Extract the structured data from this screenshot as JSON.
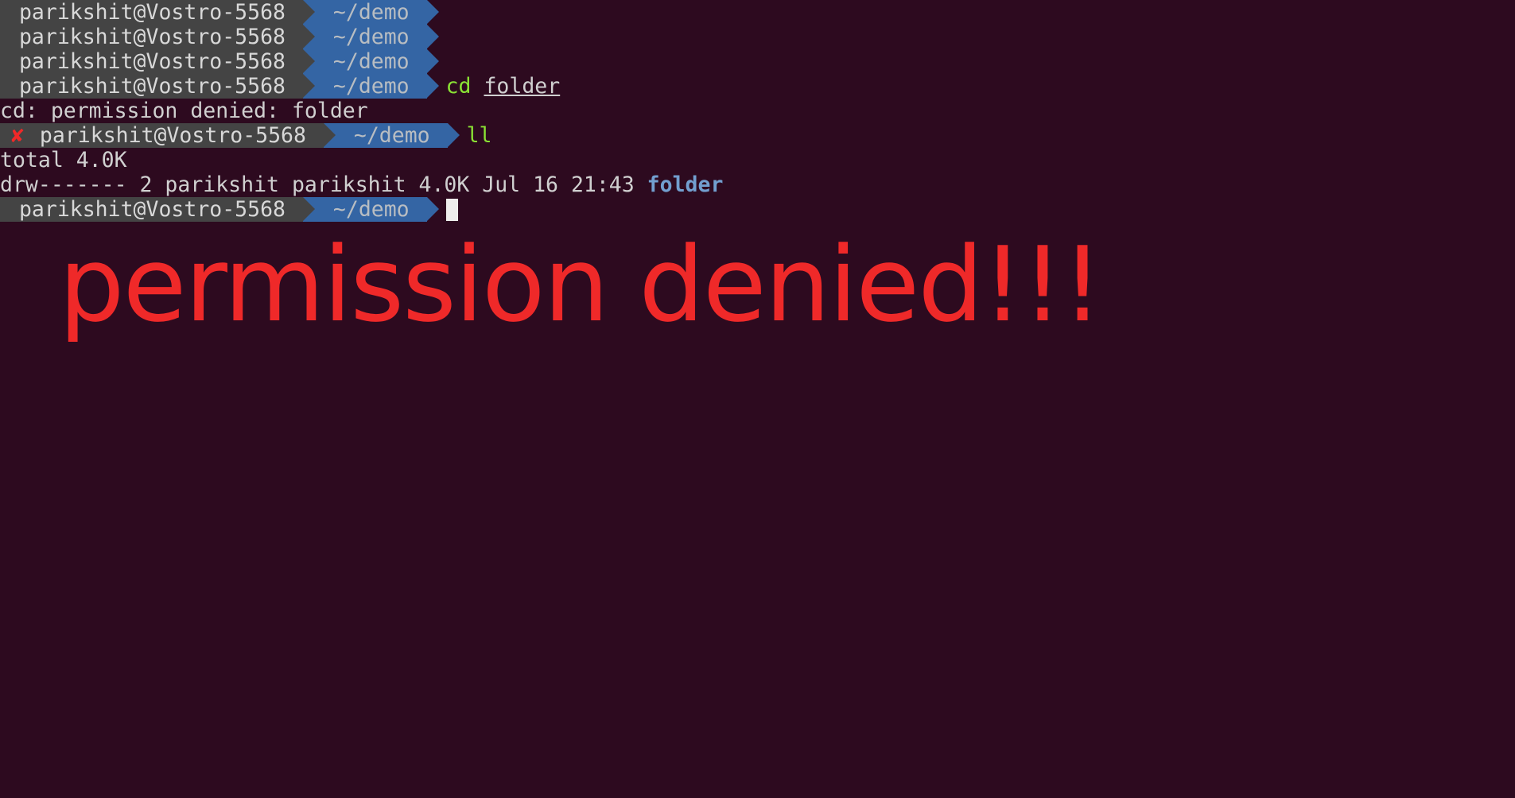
{
  "prompts": [
    {
      "user": " parikshit@Vostro-5568 ",
      "path": " ~/demo ",
      "error": false,
      "cmd": "",
      "arg": "",
      "cursor": false
    },
    {
      "user": " parikshit@Vostro-5568 ",
      "path": " ~/demo ",
      "error": false,
      "cmd": "",
      "arg": "",
      "cursor": false
    },
    {
      "user": " parikshit@Vostro-5568 ",
      "path": " ~/demo ",
      "error": false,
      "cmd": "",
      "arg": "",
      "cursor": false
    },
    {
      "user": " parikshit@Vostro-5568 ",
      "path": " ~/demo ",
      "error": false,
      "cmd": "cd ",
      "arg": "folder",
      "arg_underline": true,
      "cursor": false
    }
  ],
  "output1": "cd: permission denied: folder",
  "prompt_err": {
    "user": " parikshit@Vostro-5568 ",
    "path": " ~/demo ",
    "error": true,
    "error_mark": "✘",
    "cmd": "ll",
    "arg": "",
    "cursor": false
  },
  "output2_line1": "total 4.0K",
  "output2_line2_pre": "drw------- 2 parikshit parikshit 4.0K Jul 16 21:43 ",
  "output2_line2_folder": "folder",
  "prompt_final": {
    "user": " parikshit@Vostro-5568 ",
    "path": " ~/demo ",
    "error": false,
    "cmd": "",
    "arg": "",
    "cursor": true
  },
  "overlay": "permission denied!!!"
}
